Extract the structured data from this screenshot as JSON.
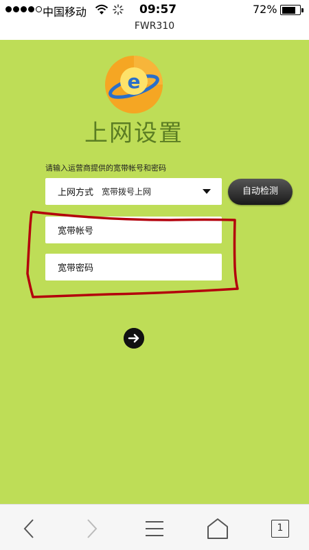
{
  "status_bar": {
    "carrier": "中国移动",
    "time": "09:57",
    "battery_percent": "72%",
    "battery_level": 0.72,
    "signal_bars_filled": 4,
    "signal_bars_total": 5
  },
  "browser": {
    "page_title": "FWR310",
    "tab_count": "1"
  },
  "page": {
    "logo_letter": "e",
    "title": "上网设置",
    "instruction": "请输入运营商提供的宽带帐号和密码",
    "connection_type": {
      "label": "上网方式",
      "value": "宽带拨号上网"
    },
    "auto_detect_label": "自动检测",
    "account_placeholder": "宽带帐号",
    "password_placeholder": "宽带密码"
  },
  "colors": {
    "background": "#bedd57",
    "title": "#5b7d23",
    "logo_orange": "#f5a623",
    "annotation_red": "#b3000c"
  }
}
